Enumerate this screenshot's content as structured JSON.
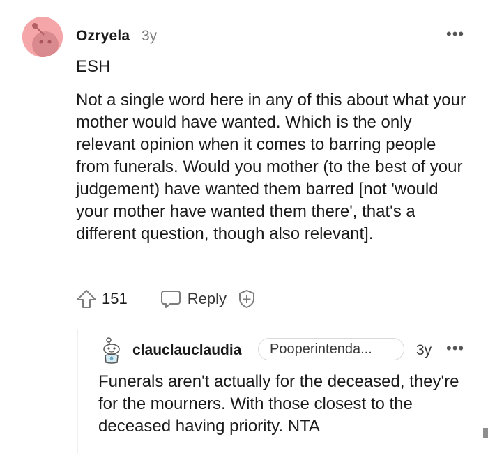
{
  "comment": {
    "author": "Ozryela",
    "age": "3y",
    "verdict": "ESH",
    "body": "Not a single word here in any of this about what your mother would have wanted. Which is the only relevant opinion when it comes to barring people from funerals. Would you mother (to the best of your judgement) have wanted them barred [not 'would your mother have wanted them there', that's a different question, though also relevant].",
    "score": "151",
    "reply_label": "Reply",
    "more_label": "•••",
    "avatar_color": "#f4a6a8"
  },
  "reply": {
    "author": "clauclauclaudia",
    "flair": "Pooperintenda...",
    "age": "3y",
    "more_label": "•••",
    "body": "Funerals aren't actually for the deceased, they're for the mourners. With those closest to the deceased having priority. NTA"
  },
  "icons": {
    "upvote": "upvote-arrow-icon",
    "reply": "speech-bubble-icon",
    "award": "add-award-icon",
    "more": "more-options-icon"
  }
}
